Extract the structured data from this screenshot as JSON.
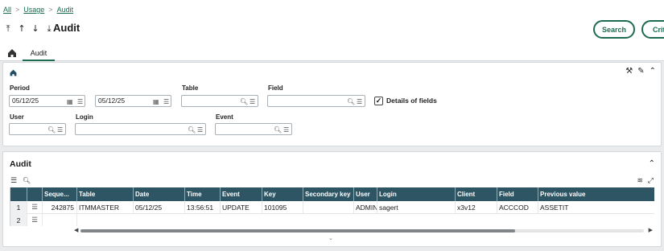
{
  "breadcrumb": {
    "items": [
      "All",
      "Usage",
      "Audit"
    ],
    "sep": ">"
  },
  "header": {
    "title": "Audit",
    "arrows": [
      "⤒",
      "↑",
      "↓",
      "⤓"
    ],
    "search_label": "Search",
    "criteria_label": "Crit"
  },
  "tabs": {
    "active": "Audit"
  },
  "filters": {
    "period_label": "Period",
    "period_from": "05/12/25",
    "period_to": "05/12/25",
    "table_label": "Table",
    "table_value": "",
    "field_label": "Field",
    "field_value": "",
    "details_label": "Details of fields",
    "details_checked": "✓",
    "user_label": "User",
    "user_value": "",
    "login_label": "Login",
    "login_value": "",
    "event_label": "Event",
    "event_value": ""
  },
  "grid": {
    "title": "Audit",
    "columns": [
      "Seque...",
      "Table",
      "Date",
      "Time",
      "Event",
      "Key",
      "Secondary key",
      "User",
      "Login",
      "Client",
      "Field",
      "Previous value"
    ],
    "rows": [
      {
        "num": "1",
        "seq": "242875",
        "table": "ITMMASTER",
        "date": "05/12/25",
        "time": "13:56:51",
        "event": "UPDATE",
        "key": "101095",
        "secondary_key": "",
        "user": "ADMIN",
        "login": "sagert",
        "client": "x3v12",
        "field": "ACCCOD",
        "previous": "ASSETIT"
      },
      {
        "num": "2",
        "seq": "",
        "table": "",
        "date": "",
        "time": "",
        "event": "",
        "key": "",
        "secondary_key": "",
        "user": "",
        "login": "",
        "client": "",
        "field": "",
        "previous": ""
      }
    ]
  }
}
